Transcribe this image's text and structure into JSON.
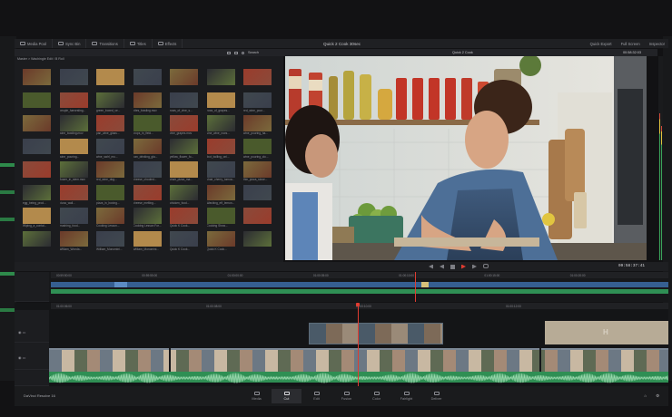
{
  "app": {
    "project_title": "Quick 2 Cook 30sec",
    "brand": "DaVinci Resolve 16"
  },
  "topbar": {
    "tools": [
      {
        "name": "media-pool",
        "label": "Media Pool"
      },
      {
        "name": "sync-bin",
        "label": "Sync Bin"
      },
      {
        "name": "transitions",
        "label": "Transitions"
      },
      {
        "name": "titles",
        "label": "Titles"
      },
      {
        "name": "effects",
        "label": "Effects"
      }
    ],
    "right": [
      {
        "name": "quick-export",
        "label": "Quick Export"
      },
      {
        "name": "full-screen",
        "label": "Full Screen"
      },
      {
        "name": "inspector",
        "label": "Inspector"
      }
    ]
  },
  "media_pool": {
    "search_label": "Search",
    "path": "Master > Wachingle Edit / B Roll",
    "clips": [
      "",
      "",
      "",
      "",
      "",
      "",
      "",
      "",
      "people_harvesting...",
      "green_boxed_ve...",
      "bites_bowling.mov",
      "rows_of_vine_s...",
      "rows_of_grapes...",
      "red_wine_pour...",
      "",
      "wine_bowling.mov",
      "pan_wine_glass...",
      "crops_in_field...",
      "vine_grapes.mov",
      "vine_wine_rows...",
      "wine_pouring_ha...",
      "",
      "wine_pouring...",
      "wine_swirl_mo...",
      "pan_drinking_gla...",
      "yellow_flower_fo...",
      "tbot_boiling_oni...",
      "wine_pouring_clo...",
      "",
      "flower_in_stem.mov",
      "red_wine_dog...",
      "cheese_chooled...",
      "chair_pizza_ma...",
      "chair_cherry_tomoa...",
      "thin_pizza_stove...",
      "egg_being_prod...",
      "pizza_wall...",
      "pizza_in_boxing...",
      "cheese_melting...",
      "chicken_food...",
      "Washing_eft_lemon...",
      "",
      "Wiping_a_contai...",
      "mashing_food...",
      "Cooking Lesson...",
      "Cooking Lesson For...",
      "Quick K Cook...",
      "Cooking Show...",
      "",
      "",
      "William_Wonda...",
      "William_Monomini...",
      "William_Monomini...",
      "Quick K Cook...",
      "Quick K Cook...",
      ""
    ]
  },
  "viewer": {
    "title": "Quick 2 Cook",
    "timecode": "00:58:32:03",
    "transport_timecode": "09:58:37:41"
  },
  "timeline": {
    "upper_ruler": [
      "00:59:50:00",
      "00:59:55:00",
      "01:00:00:00",
      "01:00:05:00",
      "01:00:10:00",
      "01:00:15:00",
      "01:00:20:00"
    ],
    "lower_ruler": [
      "01:00:06:00",
      "01:00:08:00",
      "01:00:10:00",
      "01:00:12:00"
    ]
  },
  "pages": [
    {
      "name": "media",
      "label": "Media",
      "active": false
    },
    {
      "name": "cut",
      "label": "Cut",
      "active": true
    },
    {
      "name": "edit",
      "label": "Edit",
      "active": false
    },
    {
      "name": "fusion",
      "label": "Fusion",
      "active": false
    },
    {
      "name": "color",
      "label": "Color",
      "active": false
    },
    {
      "name": "fairlight",
      "label": "Fairlight",
      "active": false
    },
    {
      "name": "deliver",
      "label": "Deliver",
      "active": false
    }
  ],
  "colors": {
    "audio_green": "#2f8f54",
    "video_blue": "#3a76b8",
    "playhead_red": "#e03c31",
    "accent": "#d7be5c"
  }
}
